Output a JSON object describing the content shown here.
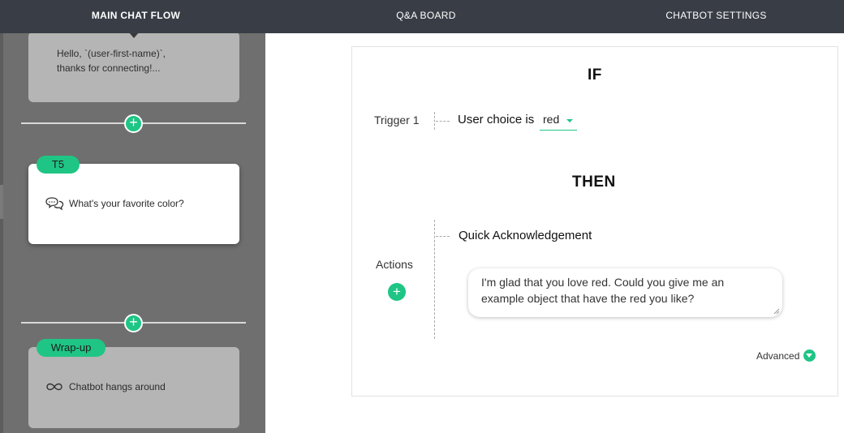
{
  "nav": {
    "tabs": [
      {
        "label": "MAIN CHAT FLOW",
        "active": true
      },
      {
        "label": "Q&A BOARD",
        "active": false
      },
      {
        "label": "CHATBOT SETTINGS",
        "active": false
      }
    ]
  },
  "flow": {
    "intro_card": {
      "text_line1": "Hello, `(user-first-name)`,",
      "text_line2": "thanks for connecting!..."
    },
    "t5_card": {
      "badge": "T5",
      "icon": "chat-bubbles-icon",
      "text": "What's your favorite color?"
    },
    "wrapup_card": {
      "badge": "Wrap-up",
      "icon": "infinity-icon",
      "text": "Chatbot hangs around"
    },
    "add_icon": "plus-icon"
  },
  "rule": {
    "if_heading": "IF",
    "trigger_label": "Trigger 1",
    "condition_text": "User choice is",
    "condition_value": "red",
    "then_heading": "THEN",
    "actions_label": "Actions",
    "action_title": "Quick Acknowledgement",
    "reply_text": "I'm glad that you love red. Could you give me an example object that have the red you like?",
    "advanced_label": "Advanced"
  },
  "colors": {
    "accent": "#1fc584",
    "nav_bg": "#393e46",
    "panel_bg": "#6f6f6f"
  }
}
